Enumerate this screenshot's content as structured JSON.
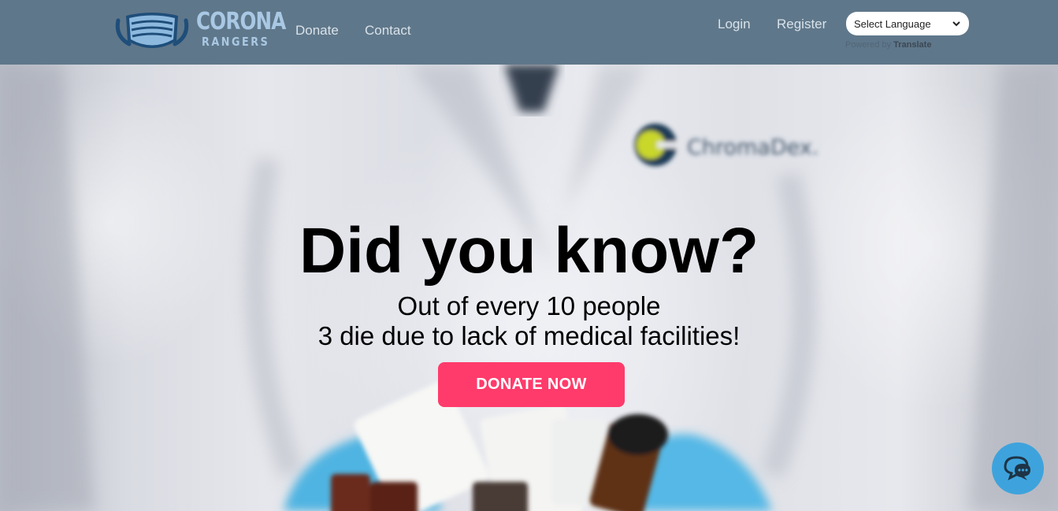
{
  "navbar": {
    "logo": {
      "line1": "CORONA",
      "line2": "RANGERS",
      "icon": "face-mask-icon"
    },
    "links": {
      "donate": "Donate",
      "contact": "Contact",
      "login": "Login",
      "register": "Register"
    },
    "language_select": {
      "selected": "Select Language",
      "icon": "chevron-down-icon"
    },
    "powered_by": {
      "prefix": "Powered by",
      "brand": "Translate"
    }
  },
  "hero": {
    "background_brand": "ChromaDex.",
    "headline": "Did you know?",
    "subline_1": "Out of every 10 people",
    "subline_2": "3 die due to lack of medical facilities!",
    "cta_label": "DONATE NOW"
  },
  "chat": {
    "icon": "chat-bubbles-icon"
  },
  "colors": {
    "navbar_bg": "#5f778a",
    "logo_color": "#a9c8e4",
    "cta_bg": "#ff3b6b",
    "chat_bg": "#3ea3dc"
  }
}
